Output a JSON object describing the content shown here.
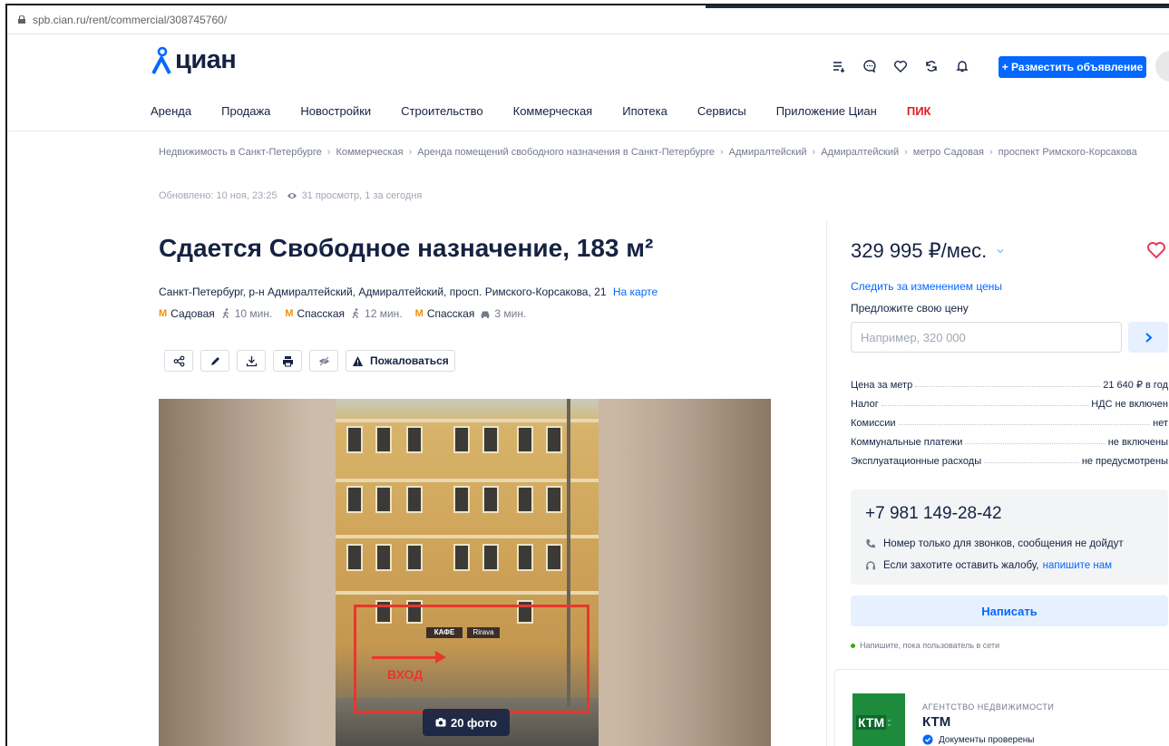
{
  "browser": {
    "url": "spb.cian.ru/rent/commercial/308745760/"
  },
  "header": {
    "logo_text": "циан",
    "post_button": "+ Разместить объявление",
    "icons": [
      "compare-icon",
      "chat-icon",
      "favorites-icon",
      "refresh-icon",
      "notifications-icon"
    ]
  },
  "nav": {
    "items": [
      "Аренда",
      "Продажа",
      "Новостройки",
      "Строительство",
      "Коммерческая",
      "Ипотека",
      "Сервисы",
      "Приложение Циан"
    ],
    "pik": "ПИК"
  },
  "breadcrumbs": {
    "items": [
      "Недвижимость в Санкт-Петербурге",
      "Коммерческая",
      "Аренда помещений свободного назначения в Санкт-Петербурге",
      "Адмиралтейский",
      "Адмиралтейский",
      "метро Садовая",
      "проспект Римского-Корсакова"
    ]
  },
  "meta": {
    "updated": "Обновлено: 10 ноя, 23:25",
    "views": "31 просмотр, 1 за сегодня"
  },
  "listing": {
    "title": "Сдается Свободное назначение, 183 м²",
    "address": "Санкт-Петербург, р-н Адмиралтейский, Адмиралтейский, просп. Римского-Корсакова, 21",
    "map_link": "На карте",
    "metros": [
      {
        "name": "Садовая",
        "time": "10 мин.",
        "mode": "walk"
      },
      {
        "name": "Спасская",
        "time": "12 мин.",
        "mode": "walk"
      },
      {
        "name": "Спасская",
        "time": "3 мин.",
        "mode": "car"
      }
    ],
    "metro_symbol": "M",
    "complain": "Пожаловаться",
    "photo_count": "20 фото",
    "photo_overlay": {
      "entrance": "ВХОД",
      "cafe": "КАФЕ",
      "sign": "Rirava"
    }
  },
  "sidebar": {
    "price": "329 995 ₽/мес.",
    "follow_price": "Следить за изменением цены",
    "suggest_label": "Предложите свою цену",
    "suggest_placeholder": "Например, 320 000",
    "params": [
      {
        "label": "Цена за метр",
        "value": "21 640 ₽ в год"
      },
      {
        "label": "Налог",
        "value": "НДС не включен"
      },
      {
        "label": "Комиссии",
        "value": "нет"
      },
      {
        "label": "Коммунальные платежи",
        "value": "не включены"
      },
      {
        "label": "Эксплуатационные расходы",
        "value": "не предусмотрены"
      }
    ],
    "phone": "+7 981 149-28-42",
    "phone_note": "Номер только для звонков, сообщения не дойдут",
    "complaint_note": "Если захотите оставить жалобу,",
    "complaint_link": "напишите нам",
    "write_button": "Написать",
    "online_note": "Напишите, пока пользователь в сети",
    "agency": {
      "type": "АГЕНТСТВО НЕДВИЖИМОСТИ",
      "name": "КТМ",
      "logo_text": "КТМ",
      "verified": "Документы проверены"
    }
  },
  "colors": {
    "brand_blue": "#0468ff",
    "text_dark": "#152242",
    "metro_orange": "#f29100",
    "pik_red": "#e51b23"
  }
}
